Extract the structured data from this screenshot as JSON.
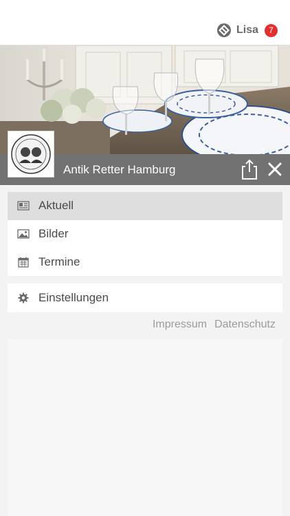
{
  "header": {
    "user_name": "Lisa",
    "notification_count": "7",
    "badge_color": "#e23030",
    "app_logo_icon": "diamond-logo-icon"
  },
  "page": {
    "title": "Antik Retter Hamburg",
    "share_icon": "share-icon",
    "close_icon": "close-icon",
    "hero_image": "table-setting-photo",
    "brand_logo": "antik-retter-logo"
  },
  "menu": {
    "items": [
      {
        "label": "Aktuell",
        "icon": "newspaper-icon",
        "active": true
      },
      {
        "label": "Bilder",
        "icon": "image-icon",
        "active": false
      },
      {
        "label": "Termine",
        "icon": "calendar-icon",
        "active": false
      }
    ],
    "settings": {
      "label": "Einstellungen",
      "icon": "gear-icon"
    }
  },
  "footer": {
    "impressum": "Impressum",
    "datenschutz": "Datenschutz"
  },
  "colors": {
    "titlebar": "#727272",
    "active_item": "#dedede",
    "text": "#4a4a4a",
    "footer_text": "#9b9b9b"
  }
}
